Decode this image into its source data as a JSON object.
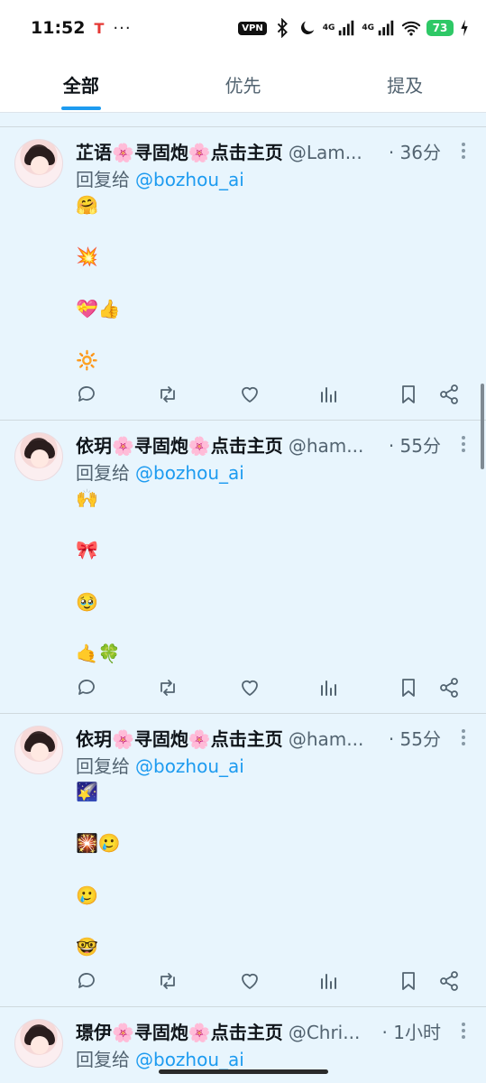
{
  "status": {
    "time": "11:52",
    "dots": "···",
    "vpn": "VPN",
    "net1": "4G",
    "net2": "4G",
    "battery": "73"
  },
  "tabs": [
    {
      "label": "全部",
      "active": true
    },
    {
      "label": "优先",
      "active": false
    },
    {
      "label": "提及",
      "active": false
    }
  ],
  "tweets": [
    {
      "name": "芷语🌸寻固炮🌸点击主页",
      "handle": "@Lam...",
      "time": "· 36分",
      "reply_prefix": "回复给",
      "reply_to": "@bozhou_ai",
      "lines": [
        "🤗",
        "💥",
        "💝👍",
        "🔆"
      ]
    },
    {
      "name": "依玥🌸寻固炮🌸点击主页",
      "handle": "@ham...",
      "time": "· 55分",
      "reply_prefix": "回复给",
      "reply_to": "@bozhou_ai",
      "lines": [
        "🙌",
        "🎀",
        "🥹",
        "🤙🍀"
      ]
    },
    {
      "name": "依玥🌸寻固炮🌸点击主页",
      "handle": "@ham...",
      "time": "· 55分",
      "reply_prefix": "回复给",
      "reply_to": "@bozhou_ai",
      "lines": [
        "🌠",
        "🎇🥲",
        "🥲",
        "🤓"
      ]
    },
    {
      "name": "璟伊🌸寻固炮🌸点击主页",
      "handle": "@Chri...",
      "time": "· 1小时",
      "reply_prefix": "回复给",
      "reply_to": "@bozhou_ai",
      "lines": []
    }
  ],
  "icons": {
    "reply": "reply-icon",
    "retweet": "retweet-icon",
    "like": "heart-icon",
    "views": "views-icon",
    "bookmark": "bookmark-icon",
    "share": "share-icon",
    "more": "more-icon"
  },
  "colors": {
    "accent": "#1d9bf0",
    "background": "#e8f5fd",
    "muted": "#536471"
  }
}
